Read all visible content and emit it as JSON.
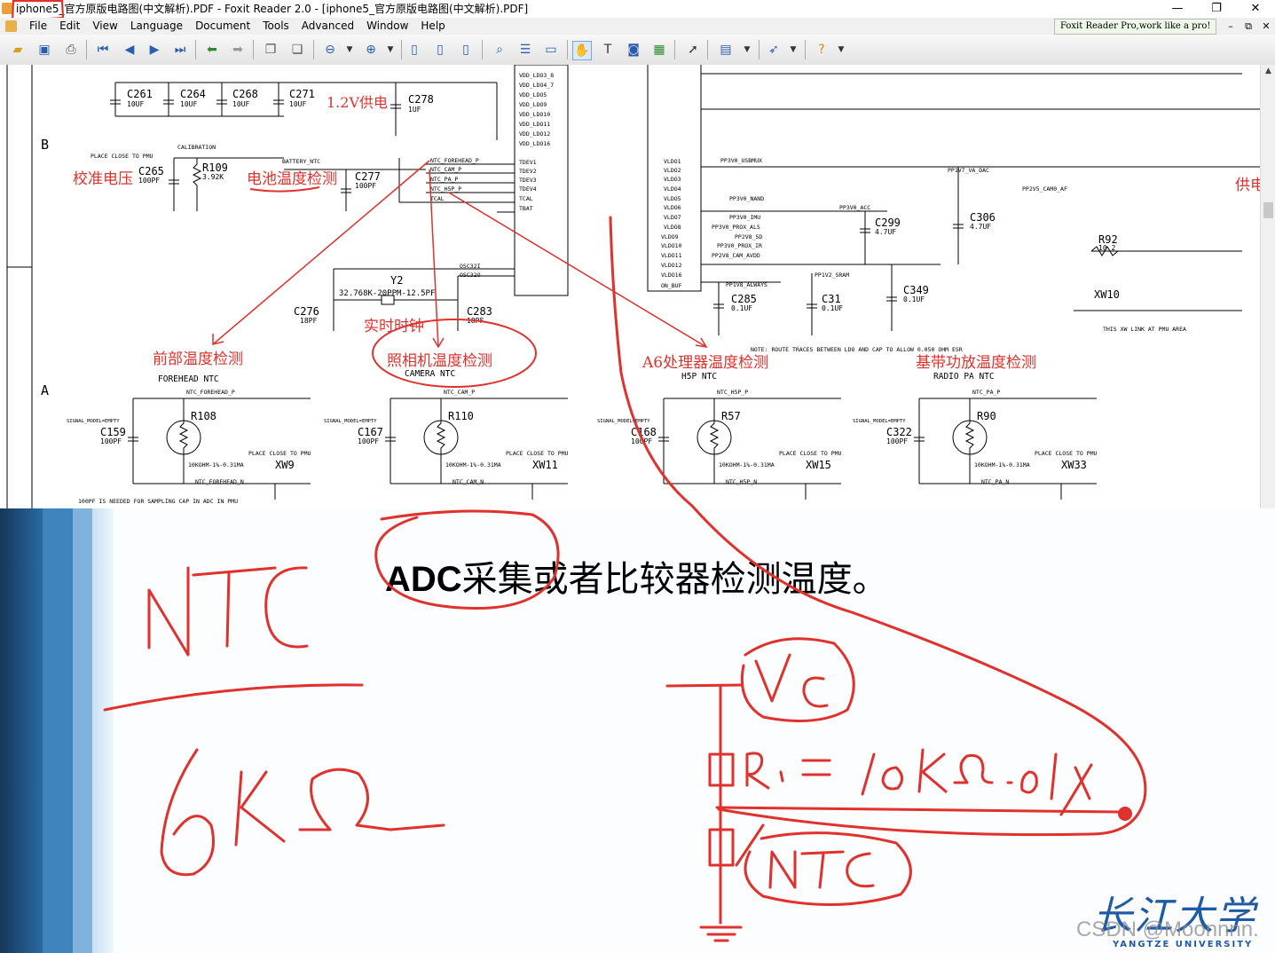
{
  "window": {
    "title_prefix": "iphone5",
    "title_rest": "_官方原版电路图(中文解析).PDF - Foxit Reader 2.0 - [iphone5_官方原版电路图(中文解析).PDF]",
    "controls": {
      "minimize": "—",
      "maximize": "❐",
      "close": "✕"
    }
  },
  "menu": {
    "items": [
      "File",
      "Edit",
      "View",
      "Language",
      "Document",
      "Tools",
      "Advanced",
      "Window",
      "Help"
    ],
    "ad_text": "Foxit Reader Pro,work like a pro!",
    "doc_controls": {
      "minimize": "–",
      "restore": "⧉",
      "close": "✕"
    }
  },
  "toolbar": {
    "icons": [
      "open-icon",
      "save-icon",
      "print-icon",
      "first-page-icon",
      "prev-page-icon",
      "next-page-icon",
      "last-page-icon",
      "back-icon",
      "forward-icon",
      "copy-icon",
      "paste-icon",
      "zoom-out-icon",
      "zoom-in-icon",
      "single-page-icon",
      "continuous-icon",
      "facing-icon",
      "find-icon",
      "bookmark-icon",
      "fit-icon",
      "hand-icon",
      "text-select-icon",
      "snapshot-icon",
      "image-icon",
      "select-icon",
      "comment-icon",
      "link-icon",
      "help-icon"
    ]
  },
  "schematic": {
    "row_labels": [
      "B",
      "A"
    ],
    "capacitors_top": [
      {
        "ref": "C261",
        "val": "10UF"
      },
      {
        "ref": "C264",
        "val": "10UF"
      },
      {
        "ref": "C268",
        "val": "10UF"
      },
      {
        "ref": "C271",
        "val": "10UF"
      },
      {
        "ref": "C278",
        "val": "1UF"
      }
    ],
    "cn_labels": {
      "v12": "1.2V供电",
      "calib": "校准电压",
      "battery": "电池温度检测",
      "rtc": "实时时钟",
      "forehead": "前部温度检测",
      "camera": "照相机温度检测",
      "a6": "A6处理器温度检测",
      "radio": "基带功放温度检测",
      "supply": "供电"
    },
    "misc_labels": {
      "place_close": "PLACE CLOSE TO PMU",
      "calibration": "CALIBRATION",
      "battery_ntc": "BATTERY_NTC",
      "r109": "R109",
      "r109_val": "3.92K",
      "c265": "C265",
      "c265_val": "100PF",
      "c277": "C277",
      "c277_val": "100PF",
      "y2": "Y2",
      "y2_val": "32.768K-20PPM-12.5PF",
      "c276": "C276",
      "c276_val": "18PF",
      "c283": "C283",
      "c283_val": "18PF",
      "osc_in": "OSC32I",
      "osc_out": "OSC32O",
      "note": "NOTE: ROUTE TRACES BETWEEN LDO AND CAP TO ALLOW 0.050 OHM ESR",
      "bottom_note": "100PF IS NEEDED FOR SAMPLING CAP IN ADC IN PMU",
      "xw_note": "THIS XW LINK AT PMU AREA",
      "c299": "C299",
      "c299_val": "4.7UF",
      "c306": "C306",
      "c306_val": "4.7UF",
      "r92": "R92",
      "r92_val": "10.2",
      "xw10": "XW10",
      "c285": "C285",
      "c285_val": "0.1UF",
      "c31": "C31",
      "c31_val": "0.1UF",
      "c349": "C349",
      "c349_val": "0.1UF"
    },
    "pins_left": [
      "VDD_LDO3_8",
      "VDD_LDO4_7",
      "VDD_LDO5",
      "VDD_LDO9",
      "VDD_LDO10",
      "VDD_LDO11",
      "VDD_LDO12",
      "VDD_LDO16"
    ],
    "pins_tdev": [
      "TDEV1",
      "TDEV2",
      "TDEV3",
      "TDEV4",
      "TCAL",
      "TBAT"
    ],
    "ntc_nets": [
      "NTC_FOREHEAD_P",
      "NTC_CAM_P",
      "NTC_PA_P",
      "NTC_H5P_P",
      "TCAL"
    ],
    "pins_right": [
      "VLDO1",
      "VLDO2",
      "VLDO3",
      "VLDO4",
      "VLDO5",
      "VLDO6",
      "VLDO7",
      "VLDO8",
      "VLDO9",
      "VLDO10",
      "VLDO11",
      "VLDO12",
      "VLDO16",
      "ON_BUF"
    ],
    "nets_right": [
      "PP3V0_USBMUX",
      "PP1V7_VA_DAC",
      "PP2V5_CAM0_AF",
      "PP3V0_NAND",
      "PP3V0_ACC",
      "PP3V0_IMU",
      "PP3V0_PROX_ALS",
      "PP2V8_SD",
      "PP3V0_PROX_IR",
      "PP2V8_CAM_AVDD",
      "PP1V2_SRAM",
      "PP1V8_ALWAYS"
    ],
    "ntc_blocks": [
      {
        "ref": "R108",
        "cap": "C159",
        "cap_val": "100PF",
        "xw": "XW9",
        "name": "FOREHEAD NTC",
        "net_p": "NTC_FOREHEAD_P",
        "net_n": "NTC_FOREHEAD_N",
        "res_val": "10KOHM-1%-0.31MA"
      },
      {
        "ref": "R110",
        "cap": "C167",
        "cap_val": "100PF",
        "xw": "XW11",
        "name": "CAMERA NTC",
        "net_p": "NTC_CAM_P",
        "net_n": "NTC_CAM_N",
        "res_val": "10KOHM-1%-0.31MA"
      },
      {
        "ref": "R57",
        "cap": "C168",
        "cap_val": "100PF",
        "xw": "XW15",
        "name": "H5P NTC",
        "net_p": "NTC_H5P_P",
        "net_n": "NTC_H5P_N",
        "res_val": "10KOHM-1%-0.31MA"
      },
      {
        "ref": "R90",
        "cap": "C322",
        "cap_val": "100PF",
        "xw": "XW33",
        "name": "RADIO PA NTC",
        "net_p": "NTC_PA_P",
        "net_n": "NTC_PA_N",
        "res_val": "10KOHM-1%-0.31MA"
      }
    ],
    "signal_model": "SIGNAL_MODEL=EMPTY",
    "place_close_pmu": "PLACE CLOSE TO PMU"
  },
  "slide": {
    "heading_bold": "ADC",
    "heading_rest": "采集或者比较器检测温度。",
    "hand_notes": {
      "ntc": "NTC",
      "value": "6KΩ",
      "vcc": "Vcc",
      "r1": "R1 = 10kΩ 0.1%",
      "ntc2": "NTC"
    },
    "logo_text": "长江大学",
    "logo_sub": "YANGTZE UNIVERSITY",
    "watermark": "CSDN @Moonnnn."
  },
  "colors": {
    "annotation_red": "#e0312d",
    "menubar_bg": "#f0f0f0",
    "slide_blue": "#2a6aa0"
  }
}
